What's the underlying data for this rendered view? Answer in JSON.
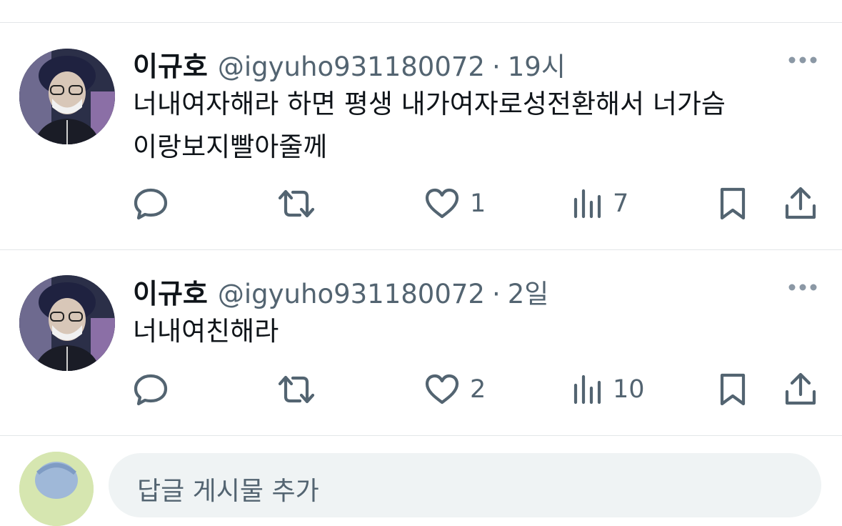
{
  "tweets": [
    {
      "display_name": "이규호",
      "handle": "@igyuho931180072",
      "separator": "·",
      "time": "19시",
      "text_lines": [
        "너내여자해라 하면 평생 내가여자로성전환해서 너가슴",
        "이랑보지빨아줄께"
      ],
      "like_count": "1",
      "view_count": "7"
    },
    {
      "display_name": "이규호",
      "handle": "@igyuho931180072",
      "separator": "·",
      "time": "2일",
      "text_lines": [
        "너내여친해라"
      ],
      "like_count": "2",
      "view_count": "10"
    }
  ],
  "reply": {
    "placeholder": "답글 게시물 추가"
  },
  "icons": {
    "more": "more-icon",
    "reply": "reply-icon",
    "retweet": "retweet-icon",
    "like": "heart-icon",
    "views": "views-icon",
    "bookmark": "bookmark-icon",
    "share": "share-icon"
  },
  "colors": {
    "text": "#0f1419",
    "secondary": "#536471",
    "divider": "#e3e6e8",
    "input_bg": "#eff3f4"
  }
}
